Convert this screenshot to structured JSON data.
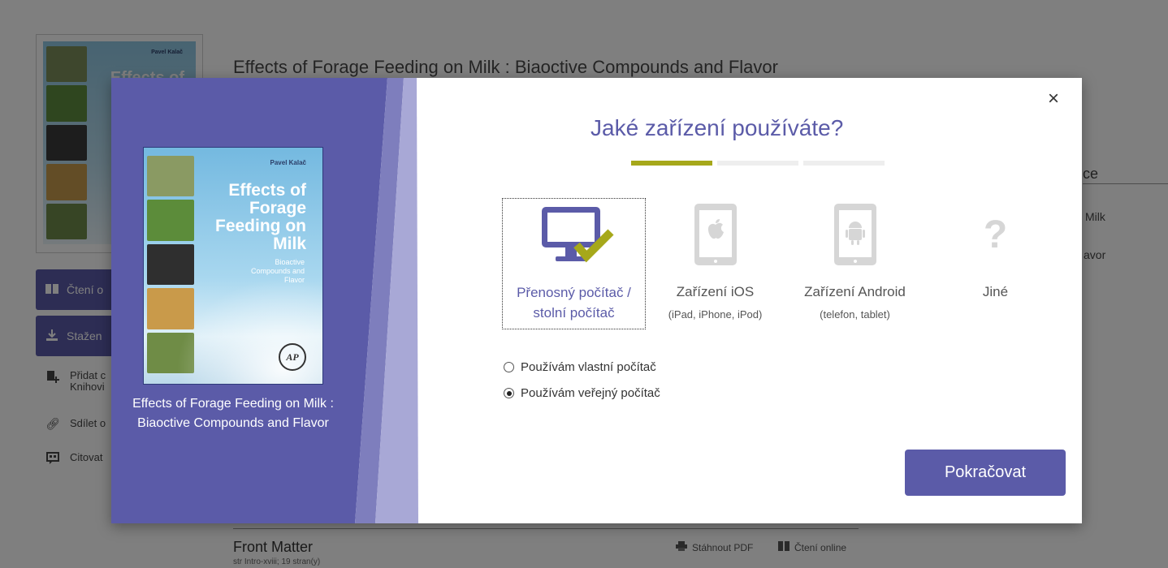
{
  "background_page": {
    "cover": {
      "author": "Pavel Kalač",
      "title_fragment": "Effects of"
    },
    "title": "Effects of Forage Feeding on Milk : Biaoctive Compounds and Flavor",
    "read_button": "Čtení o",
    "download_button": "Stažen",
    "add_link": [
      "Přidat c",
      "Knihovi"
    ],
    "share_link": "Sdílet o",
    "cite_link": "Citovat",
    "right_heading_fragment": "ce",
    "right_milk_fragment": "Milk",
    "right_avor_fragment": "avor",
    "section_title": "Front Matter",
    "section_pages": "str Intro-xviii; 19 stran(y)",
    "download_pdf": "Stáhnout PDF",
    "read_online": "Čtení online"
  },
  "modal": {
    "book_cover": {
      "author": "Pavel Kalač",
      "title": "Effects of Forage Feeding on Milk",
      "subtitle": "Bioactive Compounds and Flavor",
      "publisher_logo": "AP"
    },
    "book_title": "Effects of Forage Feeding on Milk : Biaoctive Compounds and Flavor",
    "close_symbol": "×",
    "heading": "Jaké zařízení používáte?",
    "progress": {
      "steps": 3,
      "current": 1
    },
    "devices": [
      {
        "label": "Přenosný počítač / stolní počítač",
        "sub": "",
        "icon": "desktop-check-icon",
        "selected": true
      },
      {
        "label": "Zařízení iOS",
        "sub": "(iPad, iPhone, iPod)",
        "icon": "ios-tablet-icon",
        "selected": false
      },
      {
        "label": "Zařízení Android",
        "sub": "(telefon, tablet)",
        "icon": "android-tablet-icon",
        "selected": false
      },
      {
        "label": "Jiné",
        "sub": "",
        "icon": "question-mark-icon",
        "selected": false
      }
    ],
    "computer_options": [
      {
        "label": "Používám vlastní počítač",
        "checked": false
      },
      {
        "label": "Používám veřejný počítač",
        "checked": true
      }
    ],
    "continue_button": "Pokračovat"
  },
  "colors": {
    "accent": "#5b5ba8",
    "progress_active": "#a6a81a",
    "checkmark": "#a6a81a",
    "device_icon_gray": "#d6d6d6"
  }
}
